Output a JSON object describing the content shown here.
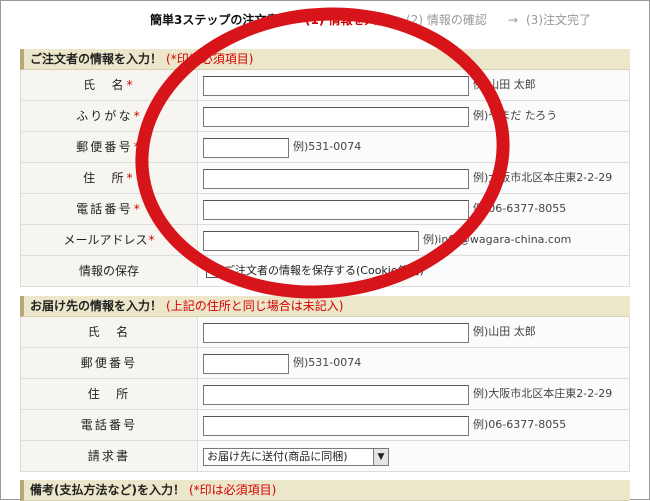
{
  "steps": {
    "title": "簡単3ステップの注文書！",
    "step1": "(1) 情報を入力",
    "arrow": "→",
    "step2": "(2) 情報の確認",
    "step3": "(3)注文完了"
  },
  "orderer": {
    "heading": "ご注文者の情報を入力！",
    "note": "(*印は必須項目)",
    "required_mark": "*",
    "rows": {
      "name": {
        "label": "氏　名",
        "example": "例)山田 太郎",
        "value": ""
      },
      "furigana": {
        "label": "ふりがな",
        "example": "例)やまだ たろう",
        "value": ""
      },
      "zip": {
        "label": "郵便番号",
        "example": "例)531-0074",
        "value": ""
      },
      "address": {
        "label": "住　所",
        "example": "例)大阪市北区本庄東2-2-29",
        "value": ""
      },
      "phone": {
        "label": "電話番号",
        "example": "例)06-6377-8055",
        "value": ""
      },
      "email": {
        "label": "メールアドレス",
        "example": "例)info@wagara-china.com",
        "value": ""
      },
      "save": {
        "label": "情報の保存",
        "checkbox_label": "ご注文者の情報を保存する(Cookie使用)",
        "check": "✓"
      }
    }
  },
  "delivery": {
    "heading": "お届け先の情報を入力！",
    "note": "(上記の住所と同じ場合は未記入)",
    "rows": {
      "name": {
        "label": "氏　名",
        "example": "例)山田 太郎",
        "value": ""
      },
      "zip": {
        "label": "郵便番号",
        "example": "例)531-0074",
        "value": ""
      },
      "address": {
        "label": "住　所",
        "example": "例)大阪市北区本庄東2-2-29",
        "value": ""
      },
      "phone": {
        "label": "電話番号",
        "example": "例)06-6377-8055",
        "value": ""
      },
      "invoice": {
        "label": "請求書",
        "selected": "お届け先に送付(商品に同梱)",
        "arrow": "▼"
      }
    }
  },
  "remarks": {
    "heading": "備考(支払方法など)を入力！",
    "note": "(*印は必須項目)"
  },
  "colors": {
    "accent": "#d40000",
    "ring": "#d7141a",
    "section_bg": "#ece7ca"
  }
}
